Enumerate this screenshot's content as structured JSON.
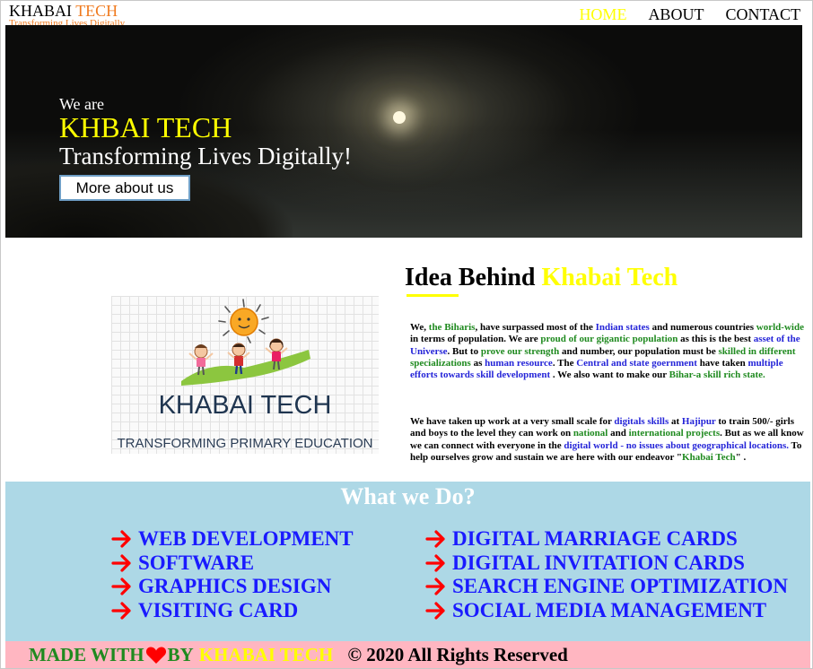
{
  "header": {
    "brand_main": "KHABAI",
    "brand_accent": "TECH",
    "tagline": "Transforming Lives Digitally",
    "nav": [
      "HOME",
      "ABOUT",
      "CONTACT"
    ]
  },
  "hero": {
    "intro": "We are",
    "title": "KHBAI TECH",
    "subtitle": "Transforming Lives Digitally!",
    "button_label": "More about us"
  },
  "logo": {
    "title": "KHABAI TECH",
    "subtitle": "TRANSFORMING PRIMARY EDUCATION"
  },
  "idea": {
    "heading_main": "Idea Behind",
    "heading_accent": "Khabai Tech",
    "p1": [
      {
        "t": "We, ",
        "c": "k"
      },
      {
        "t": "the Biharis",
        "c": "g"
      },
      {
        "t": ", have surpassed most of the ",
        "c": "k"
      },
      {
        "t": "Indian states",
        "c": "b"
      },
      {
        "t": " and numerous countries ",
        "c": "k"
      },
      {
        "t": "world-wide",
        "c": "g"
      },
      {
        "t": " in terms of population. We are ",
        "c": "k"
      },
      {
        "t": "proud of our gigantic population",
        "c": "g"
      },
      {
        "t": " as this is the best ",
        "c": "k"
      },
      {
        "t": "asset of the Universe",
        "c": "b"
      },
      {
        "t": ". But to ",
        "c": "k"
      },
      {
        "t": "prove our strength",
        "c": "g"
      },
      {
        "t": " and number, our population must be ",
        "c": "k"
      },
      {
        "t": "skilled in different specializations",
        "c": "g"
      },
      {
        "t": " as ",
        "c": "k"
      },
      {
        "t": "human resource",
        "c": "b"
      },
      {
        "t": ". The ",
        "c": "k"
      },
      {
        "t": "Central and state goernment",
        "c": "b"
      },
      {
        "t": " have taken ",
        "c": "k"
      },
      {
        "t": "multiple efforts towards skill development",
        "c": "b"
      },
      {
        "t": " . We also want to make our ",
        "c": "k"
      },
      {
        "t": "Bihar-a skill rich state.",
        "c": "g"
      }
    ],
    "p2": [
      {
        "t": "We have taken up work at a very small scale for ",
        "c": "k"
      },
      {
        "t": "digitals skills",
        "c": "b"
      },
      {
        "t": " at ",
        "c": "k"
      },
      {
        "t": "Hajipur",
        "c": "b"
      },
      {
        "t": " to train 500/- girls and boys to the level they can work on ",
        "c": "k"
      },
      {
        "t": "national",
        "c": "g"
      },
      {
        "t": " and ",
        "c": "k"
      },
      {
        "t": "international projects",
        "c": "g"
      },
      {
        "t": ". But as we all know we can connect with everyone in the ",
        "c": "k"
      },
      {
        "t": "digital world - no issues about geographical locations.",
        "c": "b"
      },
      {
        "t": " To help ourselves grow and sustain we are here with our endeavor \"",
        "c": "k"
      },
      {
        "t": "Khabai Tech",
        "c": "g"
      },
      {
        "t": "\" .",
        "c": "k"
      }
    ]
  },
  "services": {
    "title": "What we Do?",
    "col1": [
      "WEB DEVELOPMENT",
      "SOFTWARE",
      "GRAPHICS DESIGN",
      "VISITING CARD"
    ],
    "col2": [
      "DIGITAL MARRIAGE CARDS",
      "DIGITAL INVITATION CARDS",
      "SEARCH ENGINE OPTIMIZATION",
      "SOCIAL MEDIA MANAGEMENT"
    ],
    "arrow_icon": "arrow-right-icon",
    "arrow_color": "#ff0000"
  },
  "footer": {
    "made_with": "MADE WITH",
    "heart_icon": "heart-icon",
    "by": "BY",
    "brand": "KHABAI TECH",
    "copyright": "© 2020 All Rights Reserved"
  },
  "colors": {
    "accent_yellow": "#ffff00",
    "accent_orange": "#f07a1e",
    "services_bg": "#add8e6",
    "footer_bg": "#ffb6c1",
    "link_blue": "#1a1aff",
    "green": "#1f8a1f"
  }
}
